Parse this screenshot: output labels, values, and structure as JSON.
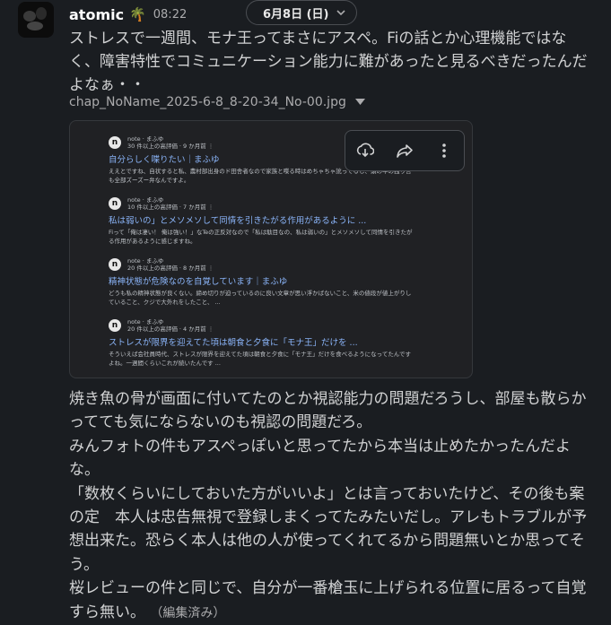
{
  "message": {
    "username": "atomic",
    "status_emoji": "🌴",
    "time": "08:22",
    "date_divider": "6月8日 (日)",
    "text": "ストレスで一週間、モナ王ってまさにアスペ。Fiの話とか心理機能ではなく、障害特性でコミュニケーション能力に難があったと見るべきだったんだよなぁ・・",
    "attachment": {
      "filename": "chap_NoName_2025-6-8_8-20-34_No-00.jpg",
      "results": [
        {
          "site": "note · まふゆ",
          "meta": "30 件以上の高評価 · 9 か月前 ⋮",
          "title": "自分らしく喋りたい｜まふゆ",
          "snippet": "ええとですね、自状すると私、農村部出身のド田舎者なので家族と喋る時はめちゃちゃ訛ってるし、頭の中の独り言も全部ズーズー弁なんですよ。"
        },
        {
          "site": "note · まふゆ",
          "meta": "10 件以上の高評価 · 7 か月前 ⋮",
          "title": "私は弱いの」とメソメソして同情を引きたがる作用があるように ...",
          "snippet": "Fiって「俺は凄い！ 俺は強い！」なTeの正反対なので「私は駄目なの、私は弱いの」とメソメソして同情を引きたがる作用があるように感じますね。"
        },
        {
          "site": "note · まふゆ",
          "meta": "20 件以上の高評価 · 8 か月前 ⋮",
          "title": "精神状態が危険なのを自覚しています｜まふゆ",
          "snippet": "どうも私の精神状態が良くない。締め切りが迫っているのに良い文章が思い浮かばないこと、米の値段が値上がりしていること、クジで大外れをしたこと、 ..."
        },
        {
          "site": "note · まふゆ",
          "meta": "20 件以上の高評価 · 4 か月前 ⋮",
          "title": "ストレスが限界を迎えてた頃は朝食と夕食に「モナ王」だけを ...",
          "snippet": "そういえば会社員時代、ストレスが限界を迎えてた頃は朝食と夕食に「モナ王」だけを食べるようになってたんですよね。一週間くらいこれが続いたんです ..."
        }
      ]
    },
    "text2": "焼き魚の骨が画面に付いてたのとか視認能力の問題だろうし、部屋も散らかってても気にならないのも視認の問題だろ。\nみんフォトの件もアスペっぽいと思ってたから本当は止めたかったんだよな。\n「数枚くらいにしておいた方がいいよ」とは言っておいたけど、その後も案の定　本人は忠告無視で登録しまくってたみたいだし。アレもトラブルが予想出来た。恐らく本人は他の人が使ってくれてるから問題無いとか思ってそう。\n桜レビューの件と同じで、自分が一番槍玉に上げられる位置に居るって自覚すら無い。",
    "edited_label": "（編集済み）"
  },
  "icons": {
    "avatar": "user-avatar",
    "download": "download-icon",
    "share": "share-icon",
    "more": "more-vertical-icon",
    "caret": "caret-down-icon"
  }
}
